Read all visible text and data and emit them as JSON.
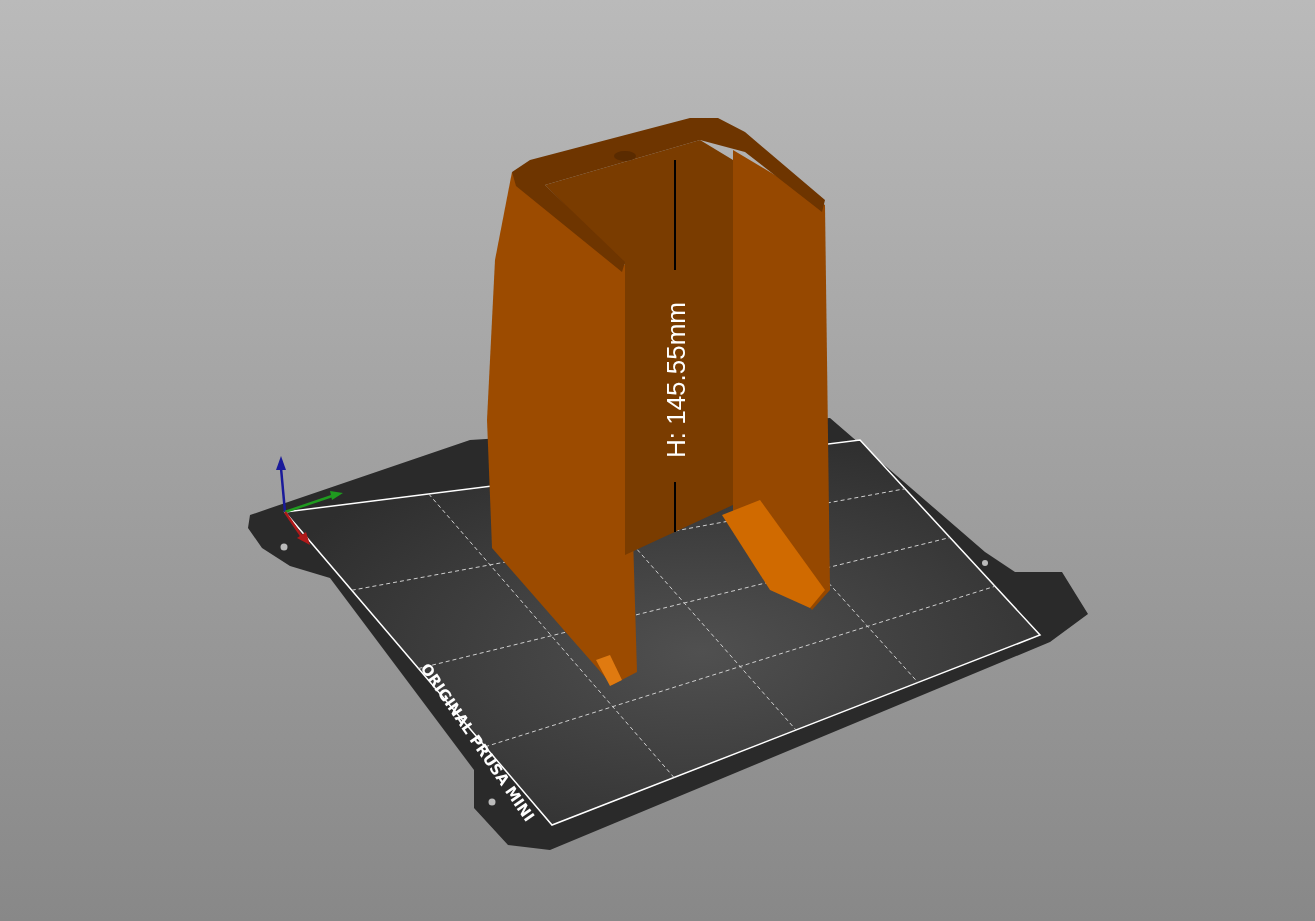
{
  "viewport": {
    "height_label": "H: 145.55mm",
    "bed_label": "ORIGINAL PRUSA MINI"
  }
}
